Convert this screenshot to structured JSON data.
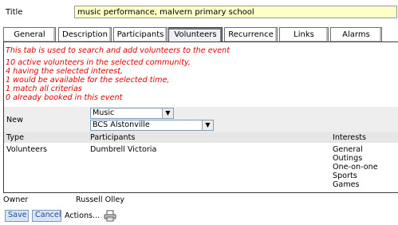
{
  "title_label": "Title",
  "title_value": "music performance, malvern primary school",
  "tabs": [
    {
      "label": "General"
    },
    {
      "label": "Description"
    },
    {
      "label": "Participants"
    },
    {
      "label": "Volunteers"
    },
    {
      "label": "Recurrence"
    },
    {
      "label": "Links"
    },
    {
      "label": "Alarms"
    }
  ],
  "active_tab": "Volunteers",
  "messages": {
    "intro": "This tab is used to search and add volunteers to the event",
    "stats": [
      "10 active volunteers in the selected community,",
      "4 having the selected interest,",
      "1 would be available for the selected time,",
      "1 match all criterias",
      "0 already booked in this event"
    ]
  },
  "new_label": "New",
  "interest_select": "Music",
  "volunteer_select": "BCS Alstonville",
  "table": {
    "headers": {
      "type": "Type",
      "participants": "Participants",
      "interests": "Interests"
    },
    "row": {
      "type": "Volunteers",
      "participant": "Dumbrell Victoria",
      "interests": [
        "General",
        "Outings",
        "One-on-one",
        "Sports",
        "Games"
      ]
    }
  },
  "owner_label": "Owner",
  "owner_value": "Russell Olley",
  "buttons": {
    "save": "Save",
    "cancel": "Cancel",
    "actions": "Actions..."
  },
  "icons": {
    "print": "printer-icon",
    "dropdown": "chevron-down-icon"
  },
  "colors": {
    "title_bg": "#ffffc8",
    "message": "#e00000",
    "button_bg": "#d7e6f7"
  }
}
